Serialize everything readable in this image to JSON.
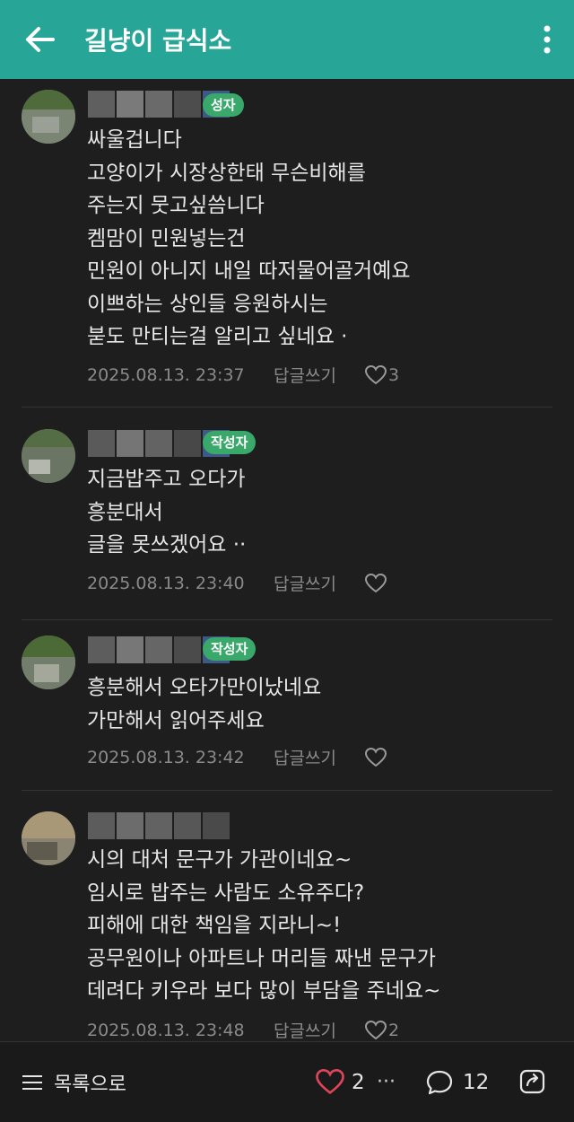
{
  "header": {
    "title": "길냥이 급식소"
  },
  "comments": [
    {
      "badge": "성자",
      "lines": [
        "싸울겁니다",
        "고양이가 시장상한태 무슨비해를",
        "주는지 뭇고싶씀니다",
        "켐맘이 민원넣는건",
        "민원이 아니지 내일 따저물어골거예요",
        "이쁘하는 상인들 응원하시는",
        "붇도 만티는걸 알리고 싶네요 ·"
      ],
      "date": "2025.08.13. 23:37",
      "reply": "답글쓰기",
      "likes": "3"
    },
    {
      "badge": "작성자",
      "lines": [
        "지금밥주고 오다가",
        "흥분대서",
        "글을 못쓰겠어요 ··"
      ],
      "date": "2025.08.13. 23:40",
      "reply": "답글쓰기",
      "likes": ""
    },
    {
      "badge": "작성자",
      "lines": [
        "흥분해서 오타가만이났네요",
        "가만해서 읽어주세요"
      ],
      "date": "2025.08.13. 23:42",
      "reply": "답글쓰기",
      "likes": ""
    },
    {
      "badge": "",
      "lines": [
        "시의 대처 문구가 가관이네요~",
        "임시로 밥주는 사람도 소유주다?",
        "피해에 대한 책임을 지라니~!",
        "공무원이나 아파트나 머리들 짜낸 문구가",
        "데려다 키우라 보다 많이 부담을 주네요~"
      ],
      "date": "2025.08.13. 23:48",
      "reply": "답글쓰기",
      "likes": "2"
    }
  ],
  "bottom_bar": {
    "list_label": "목록으로",
    "like_count": "2",
    "more_label": "···",
    "comment_count": "12"
  },
  "colors": {
    "header_bg": "#27a596",
    "badge_bg": "#3aa86b",
    "like_heart": "#e0455a"
  }
}
